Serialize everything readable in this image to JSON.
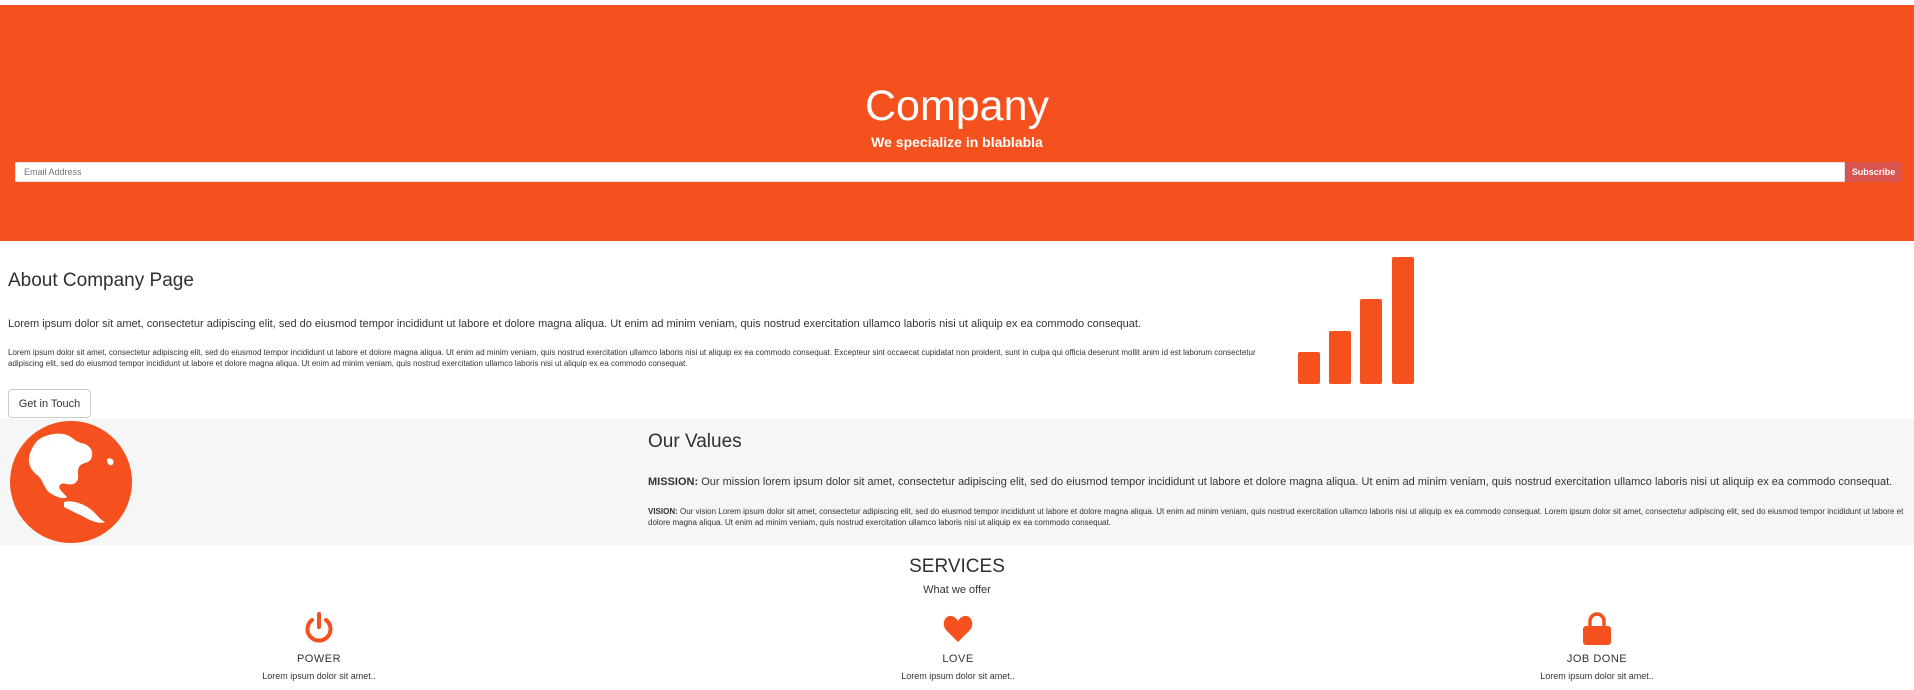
{
  "hero": {
    "title": "Company",
    "subtitle": "We specialize in blablabla",
    "email_placeholder": "Email Address",
    "subscribe_label": "Subscribe"
  },
  "about": {
    "title": "About Company Page",
    "lead": "Lorem ipsum dolor sit amet, consectetur adipiscing elit, sed do eiusmod tempor incididunt ut labore et dolore magna aliqua. Ut enim ad minim veniam, quis nostrud exercitation ullamco laboris nisi ut aliquip ex ea commodo consequat.",
    "body": "Lorem ipsum dolor sit amet, consectetur adipiscing elit, sed do eiusmod tempor incididunt ut labore et dolore magna aliqua. Ut enim ad minim veniam, quis nostrud exercitation ullamco laboris nisi ut aliquip ex ea commodo consequat. Excepteur sint occaecat cupidatat non proident, sunt in culpa qui officia deserunt mollit anim id est laborum consectetur adipiscing elit, sed do eiusmod tempor incididunt ut labore et dolore magna aliqua. Ut enim ad minim veniam, quis nostrud exercitation ullamco laboris nisi ut aliquip ex ea commodo consequat.",
    "button_label": "Get in Touch",
    "icon": "signal-icon"
  },
  "values": {
    "title": "Our Values",
    "icon": "globe-icon",
    "mission_label": "MISSION:",
    "mission_text": "Our mission lorem ipsum dolor sit amet, consectetur adipiscing elit, sed do eiusmod tempor incididunt ut labore et dolore magna aliqua. Ut enim ad minim veniam, quis nostrud exercitation ullamco laboris nisi ut aliquip ex ea commodo consequat.",
    "vision_label": "VISION:",
    "vision_text": "Our vision Lorem ipsum dolor sit amet, consectetur adipiscing elit, sed do eiusmod tempor incididunt ut labore et dolore magna aliqua. Ut enim ad minim veniam, quis nostrud exercitation ullamco laboris nisi ut aliquip ex ea commodo consequat. Lorem ipsum dolor sit amet, consectetur adipiscing elit, sed do eiusmod tempor incididunt ut labore et dolore magna aliqua. Ut enim ad minim veniam, quis nostrud exercitation ullamco laboris nisi ut aliquip ex ea commodo consequat."
  },
  "services": {
    "title": "SERVICES",
    "subtitle": "What we offer",
    "items": [
      {
        "icon": "power-icon",
        "name": "POWER",
        "desc": "Lorem ipsum dolor sit amet.."
      },
      {
        "icon": "heart-icon",
        "name": "LOVE",
        "desc": "Lorem ipsum dolor sit amet.."
      },
      {
        "icon": "lock-icon",
        "name": "JOB DONE",
        "desc": "Lorem ipsum dolor sit amet.."
      }
    ]
  },
  "colors": {
    "accent": "#f4511e",
    "subscribe": "#d9534f",
    "values_bg": "#f6f6f6"
  }
}
